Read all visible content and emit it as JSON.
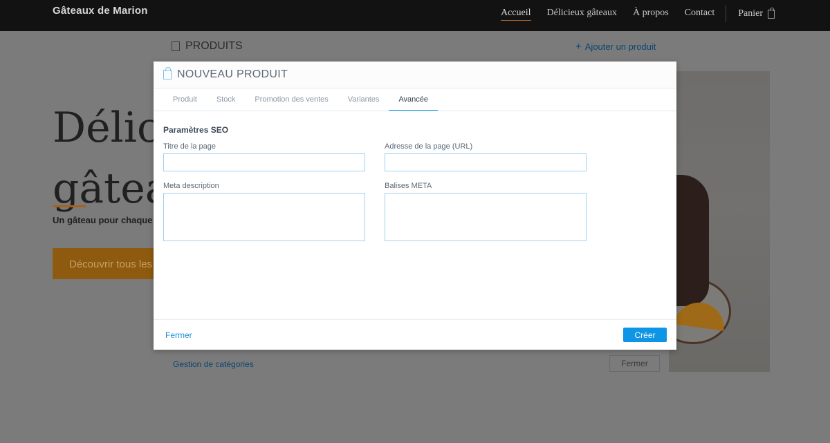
{
  "site": {
    "brand": "Gâteaux de Marion",
    "nav": [
      {
        "label": "Accueil",
        "active": true
      },
      {
        "label": "Délicieux gâteaux",
        "active": false
      },
      {
        "label": "À propos",
        "active": false
      },
      {
        "label": "Contact",
        "active": false
      }
    ],
    "cart_label": "Panier",
    "hero": {
      "title_line1": "Délici",
      "title_line2": "gâtea",
      "subtitle": "Un gâteau pour chaque",
      "cta_label": "Découvrir tous les"
    }
  },
  "products_panel": {
    "title": "PRODUITS",
    "add_label": "Ajouter un produit",
    "categories_link": "Gestion de catégories",
    "close_label": "Fermer"
  },
  "modal": {
    "title": "NOUVEAU PRODUIT",
    "tabs": [
      {
        "label": "Produit",
        "active": false
      },
      {
        "label": "Stock",
        "active": false
      },
      {
        "label": "Promotion des ventes",
        "active": false
      },
      {
        "label": "Variantes",
        "active": false
      },
      {
        "label": "Avancée",
        "active": true
      }
    ],
    "section_title": "Paramètres SEO",
    "fields": {
      "page_title_label": "Titre de la page",
      "page_title_value": "",
      "page_url_label": "Adresse de la page (URL)",
      "page_url_value": "",
      "meta_description_label": "Meta description",
      "meta_description_value": "",
      "meta_tags_label": "Balises META",
      "meta_tags_value": ""
    },
    "footer": {
      "close_label": "Fermer",
      "create_label": "Créer"
    }
  },
  "colors": {
    "accent": "#0f95e6",
    "header_bg": "#121212",
    "brand_orange": "#a5621e"
  }
}
